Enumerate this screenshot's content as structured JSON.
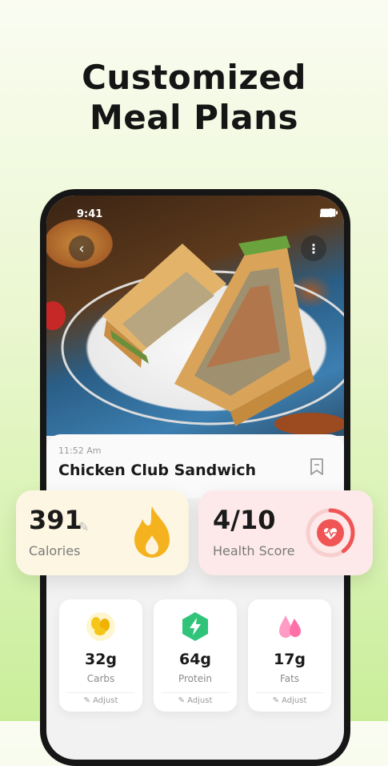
{
  "headline": {
    "line1": "Customized",
    "line2": "Meal Plans"
  },
  "status_bar": {
    "time": "9:41"
  },
  "meal": {
    "time": "11:52 Am",
    "name": "Chicken Club Sandwich"
  },
  "calories": {
    "value": "391",
    "label": "Calories"
  },
  "health_score": {
    "value": "4/10",
    "label": "Health Score",
    "fraction": 0.4
  },
  "macros": [
    {
      "value": "32g",
      "label": "Carbs",
      "adjust": "Adjust",
      "color": "#f5c518"
    },
    {
      "value": "64g",
      "label": "Protein",
      "adjust": "Adjust",
      "color": "#2fc47a"
    },
    {
      "value": "17g",
      "label": "Fats",
      "adjust": "Adjust",
      "color": "#ff7eb3"
    }
  ],
  "colors": {
    "accent": "#f4b21f",
    "health": "#f05454"
  }
}
